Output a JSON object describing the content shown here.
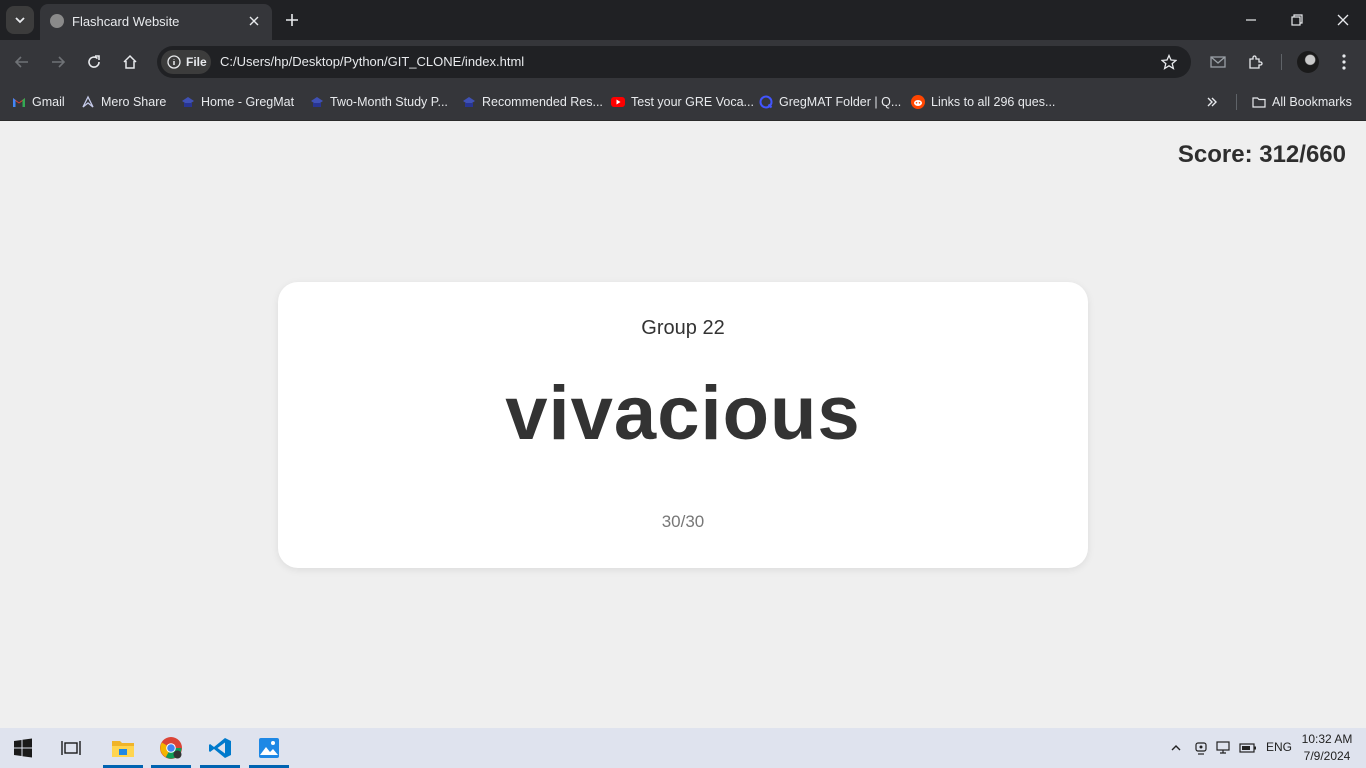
{
  "browser": {
    "tab": {
      "title": "Flashcard Website"
    },
    "omnibox": {
      "chip_label": "File",
      "url": "C:/Users/hp/Desktop/Python/GIT_CLONE/index.html"
    },
    "bookmarks": [
      {
        "label": "Gmail",
        "icon": "gmail-icon"
      },
      {
        "label": "Mero Share",
        "icon": "meroshare-icon"
      },
      {
        "label": "Home - GregMat",
        "icon": "gregmat-icon"
      },
      {
        "label": "Two-Month Study P...",
        "icon": "gregmat-icon"
      },
      {
        "label": "Recommended Res...",
        "icon": "gregmat-icon"
      },
      {
        "label": "Test your GRE Voca...",
        "icon": "youtube-icon"
      },
      {
        "label": "GregMAT Folder | Q...",
        "icon": "quizlet-icon"
      },
      {
        "label": "Links to all 296 ques...",
        "icon": "reddit-icon"
      }
    ],
    "all_bookmarks_label": "All Bookmarks"
  },
  "page": {
    "score_text": "Score: 312/660",
    "card": {
      "group": "Group 22",
      "word": "vivacious",
      "progress": "30/30"
    }
  },
  "taskbar": {
    "apps": [
      "windows-start",
      "task-view",
      "file-explorer",
      "chrome",
      "vscode",
      "photos"
    ],
    "language": "ENG",
    "time": "10:32 AM",
    "date": "7/9/2024"
  },
  "colors": {
    "page_bg": "#efefef",
    "card_bg": "#ffffff",
    "text_dark": "#333333",
    "chrome_dark": "#202124",
    "chrome_toolbar": "#35363a",
    "taskbar_bg": "#dfe3ee",
    "accent_blue": "#0063b1"
  }
}
